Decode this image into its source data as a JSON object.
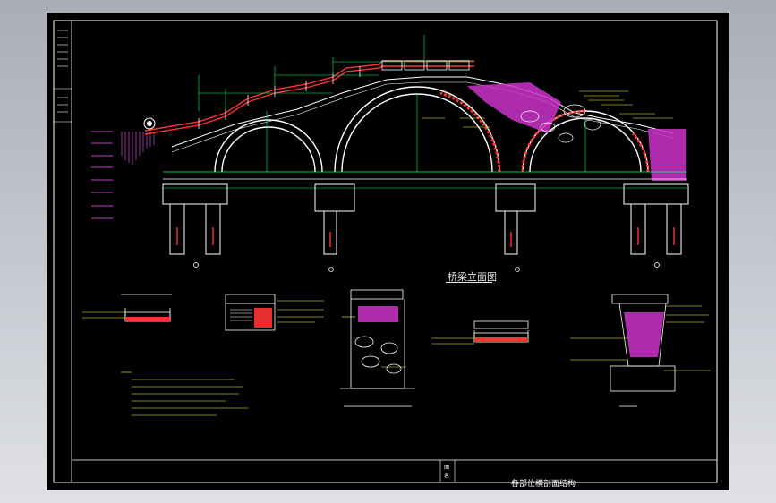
{
  "drawing": {
    "elevation_title": "桥梁立面图",
    "title_block_name": "各部位横剖面结构",
    "title_block_side_labels": [
      "图",
      "名"
    ],
    "colors": {
      "background": "#000000",
      "outline": "#ffffff",
      "dimension": "#00ff66",
      "annotation": "#ffff33",
      "masonry": "#ff3333",
      "fill": "#cc33cc",
      "section_marks": "#ff55ff"
    }
  }
}
